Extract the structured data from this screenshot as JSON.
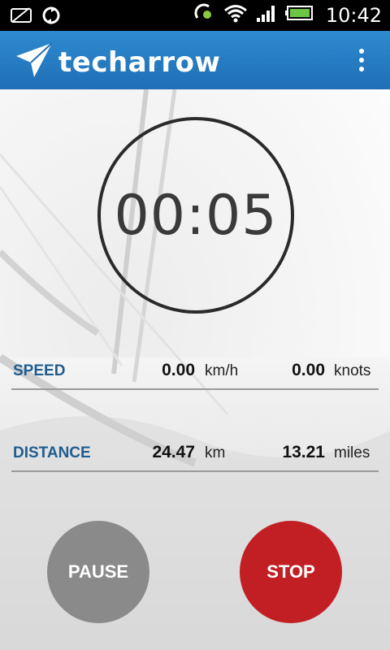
{
  "status_bar": {
    "time": "10:42",
    "icons": [
      "no-sim-icon",
      "sync-icon",
      "gps-icon",
      "wifi-icon",
      "signal-icon",
      "battery-icon"
    ]
  },
  "app_bar": {
    "brand": "techarrow",
    "logo_icon": "paper-plane-icon",
    "menu_icon": "overflow-menu-icon",
    "color": "#1f6fb5"
  },
  "timer": {
    "value": "00:05"
  },
  "speed": {
    "label": "SPEED",
    "value1": "0.00",
    "unit1": "km/h",
    "value2": "0.00",
    "unit2": "knots"
  },
  "distance": {
    "label": "DISTANCE",
    "value1": "24.47",
    "unit1": "km",
    "value2": "13.21",
    "unit2": "miles"
  },
  "buttons": {
    "pause": {
      "label": "PAUSE",
      "color": "#8a8a8a"
    },
    "stop": {
      "label": "STOP",
      "color": "#c21f24"
    }
  },
  "colors": {
    "accent": "#1f5d8f"
  }
}
